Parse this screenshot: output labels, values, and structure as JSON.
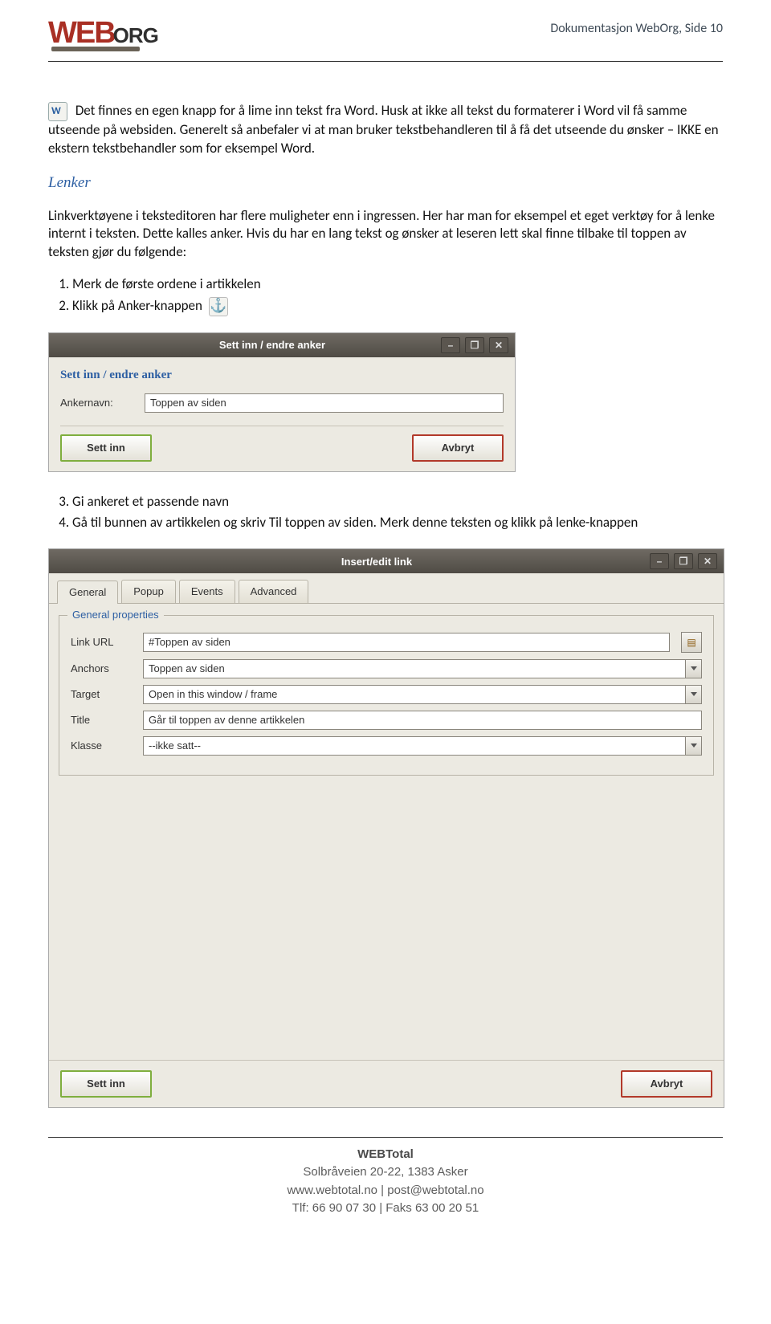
{
  "header": {
    "logo_red": "WEB",
    "logo_grey": "ORG",
    "doc_title": "Dokumentasjon WebOrg, Side 10"
  },
  "intro": {
    "p1": "Det finnes en egen knapp for å lime inn tekst fra Word. Husk at ikke all tekst du formaterer i Word vil få samme utseende på websiden. Generelt så anbefaler vi at man bruker tekstbehandleren til å få det utseende du ønsker – IKKE en ekstern tekstbehandler som for eksempel Word."
  },
  "lenker": {
    "heading": "Lenker",
    "p1": "Linkverktøyene i teksteditoren har flere muligheter enn i ingressen. Her har man for eksempel et eget verktøy for å lenke internt i teksten. Dette kalles anker. Hvis du har en lang tekst og ønsker at leseren lett skal finne tilbake til toppen av teksten gjør du følgende:",
    "steps_a": {
      "1": "Merk de første ordene i artikkelen",
      "2": "Klikk på Anker-knappen"
    },
    "steps_b": {
      "3": "Gi ankeret et passende navn",
      "4": "Gå til bunnen av artikkelen og skriv Til toppen av siden. Merk denne teksten og klikk på lenke-knappen"
    }
  },
  "anchor_dialog": {
    "titlebar": "Sett inn / endre anker",
    "heading": "Sett inn / endre anker",
    "label_name": "Ankernavn:",
    "value_name": "Toppen av siden",
    "btn_ok": "Sett inn",
    "btn_cancel": "Avbryt"
  },
  "link_dialog": {
    "titlebar": "Insert/edit link",
    "tabs": {
      "general": "General",
      "popup": "Popup",
      "events": "Events",
      "advanced": "Advanced"
    },
    "legend": "General properties",
    "labels": {
      "url": "Link URL",
      "anchors": "Anchors",
      "target": "Target",
      "title": "Title",
      "klasse": "Klasse"
    },
    "values": {
      "url": "#Toppen av siden",
      "anchors": "Toppen av siden",
      "target": "Open in this window / frame",
      "title": "Går til toppen av denne artikkelen",
      "klasse": "--ikke satt--"
    },
    "btn_ok": "Sett inn",
    "btn_cancel": "Avbryt"
  },
  "footer": {
    "company": "WEBTotal",
    "addr": "Solbråveien 20-22, 1383 Asker",
    "web": "www.webtotal.no | post@webtotal.no",
    "tel": "Tlf: 66 90 07 30 | Faks 63 00 20 51"
  }
}
